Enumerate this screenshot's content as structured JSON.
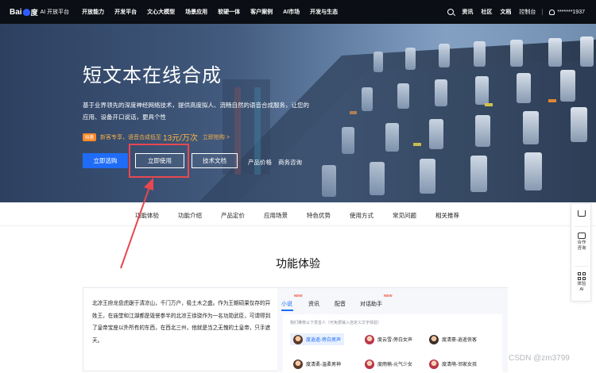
{
  "nav": {
    "logo_text": "Bai",
    "logo_du": "度",
    "logo_ai": "AI 开放平台",
    "items": [
      "开放能力",
      "开发平台",
      "文心大模型",
      "场景应用",
      "软硬一体",
      "客户案例",
      "AI市场",
      "开发与生态"
    ],
    "right": {
      "support": "资讯",
      "community": "社区",
      "docs": "文档",
      "console": "控制台",
      "user": "*******1937"
    }
  },
  "hero": {
    "title": "短文本在线合成",
    "desc": "基于业界领先的深度神经网络技术，提供高度拟人、流畅自然的语音合成服务，让您的应用、设备开口说话，更具个性",
    "promo": {
      "badge": "特惠",
      "text": "新客专享，语音合成低至",
      "price": "13元/万次",
      "link": "立即抢购 >"
    },
    "buttons": {
      "buy": "立即选购",
      "use": "立即使用",
      "doc": "技术文档"
    },
    "links": {
      "price": "产品价格",
      "consult": "商务咨询"
    }
  },
  "tabs": [
    "功能体验",
    "功能介绍",
    "产品定价",
    "应用场景",
    "特色优势",
    "使用方式",
    "常见问题",
    "相关推荐"
  ],
  "section": {
    "title": "功能体验",
    "sample_text": "北凉王府龙盘虎踞于清凉山，千门万户，极土木之盛。作为王朝硕果仅存的异姓王，在庙堂和江湖都是毁誉参半的北凉王徐骁作为一名功勋武臣，可谓得到了皇帝宝座以外所有的东西，在西北三州，他就是当之无愧的土皇帝，只手遮天。",
    "voice_tabs": [
      {
        "label": "小说",
        "new": "NEW"
      },
      {
        "label": "资讯",
        "new": ""
      },
      {
        "label": "配音",
        "new": ""
      },
      {
        "label": "对话助手",
        "new": "NEW"
      }
    ],
    "voice_hint": "我们推荐以下发音人（可免费输入自定义文字体验）",
    "voices": [
      {
        "name": "度逍遥-旁白男声",
        "selected": true,
        "avatar": "av-a"
      },
      {
        "name": "度云雪-旁白女声",
        "selected": false,
        "avatar": "av-b"
      },
      {
        "name": "度清豪-逍遥侠客",
        "selected": false,
        "avatar": "av-c"
      },
      {
        "name": "度清柔-温柔男神",
        "selected": false,
        "avatar": "av-a"
      },
      {
        "name": "度雨楠-元气少女",
        "selected": false,
        "avatar": "av-b"
      },
      {
        "name": "度清萌-邻家女孩",
        "selected": false,
        "avatar": "av-b"
      }
    ]
  },
  "sidebar": {
    "cooperate": "合作咨询",
    "experience": "体验AI"
  },
  "watermark": "CSDN @zm3799",
  "colors": {
    "accent": "#1f6cf7",
    "highlight": "#e8484f",
    "promo": "#f6b04a"
  }
}
